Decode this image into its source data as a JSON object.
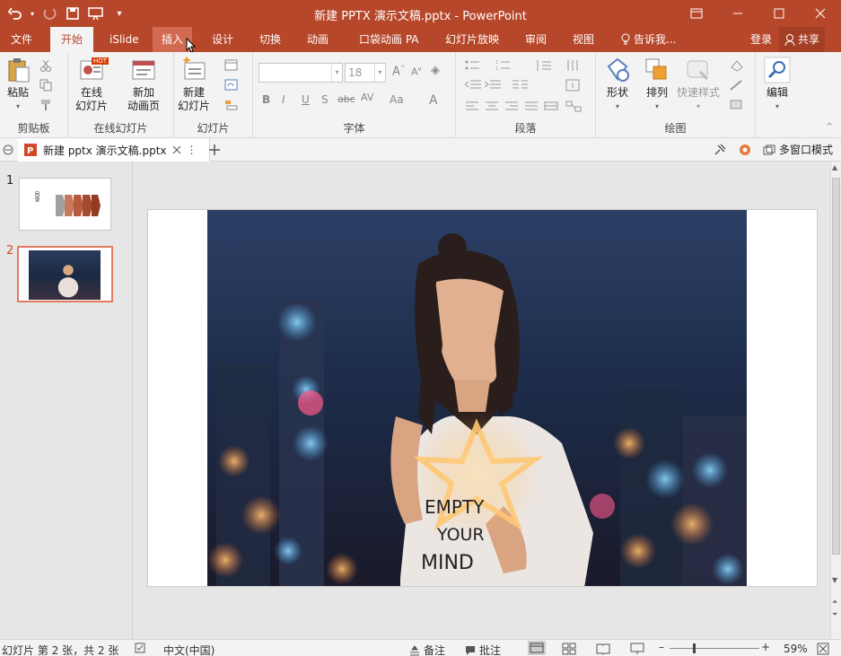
{
  "title": "新建 PPTX 演示文稿.pptx - PowerPoint",
  "tabs": [
    "文件",
    "开始",
    "iSlide",
    "插入",
    "设计",
    "切换",
    "动画",
    "口袋动画 PA",
    "幻灯片放映",
    "审阅",
    "视图"
  ],
  "tell_me": "告诉我...",
  "login": "登录",
  "share": "共享",
  "groups": {
    "clipboard": "剪贴板",
    "online_slides": "在线幻灯片",
    "slides": "幻灯片",
    "font": "字体",
    "paragraph": "段落",
    "drawing": "绘图"
  },
  "buttons": {
    "paste": "粘贴",
    "online_slide_1": "在线",
    "online_slide_2": "幻灯片",
    "new_anim_1": "新加",
    "new_anim_2": "动画页",
    "new_slide_1": "新建",
    "new_slide_2": "幻灯片",
    "shapes": "形状",
    "arrange": "排列",
    "quick_styles": "快速样式",
    "edit": "编辑",
    "hot_badge": "HOT"
  },
  "font_size": "18",
  "format_buttons": [
    "B",
    "I",
    "U",
    "S",
    "abc",
    "AV",
    "Aa",
    "A"
  ],
  "doc_tab": "新建 pptx 演示文稿.pptx",
  "multi_window": "多窗口模式",
  "slides": [
    {
      "number": "1",
      "text": "目录"
    },
    {
      "number": "2",
      "text": ""
    }
  ],
  "slide_text": [
    "EMPTY",
    "YOUR",
    "MIND"
  ],
  "status": {
    "slide_info": "幻灯片 第 2 张，共 2 张",
    "language": "中文(中国)",
    "notes": "备注",
    "comments": "批注",
    "zoom": "59%"
  },
  "colors": {
    "accent": "#b7472a",
    "ribbon": "#f3f3f3",
    "selected_thumb": "#e07a5f"
  }
}
